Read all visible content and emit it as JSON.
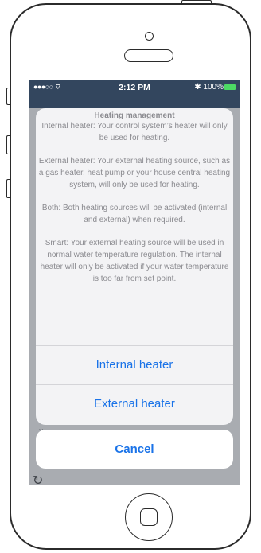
{
  "status_bar": {
    "signal": "●●●○○ ⌔",
    "time": "2:12 PM",
    "battery": "✱ 100%"
  },
  "sheet": {
    "title": "Heating management",
    "messages": [
      "Internal heater: Your control system’s heater will only be used for heating.",
      "External heater: Your external heating source, such as a gas heater, heat pump or your house central heating system, will only be used for heating.",
      "Both: Both heating sources will be activated (internal and external) when required.",
      "Smart: Your external heating source will be used in normal water temperature regulation.  The internal heater will only be activated if your water temperature is too far from set point."
    ],
    "options": [
      "Internal heater",
      "External heater"
    ],
    "cancel": "Cancel"
  },
  "colors": {
    "accent": "#1a73e8",
    "nav": "#33465e",
    "battery": "#4cd964"
  }
}
